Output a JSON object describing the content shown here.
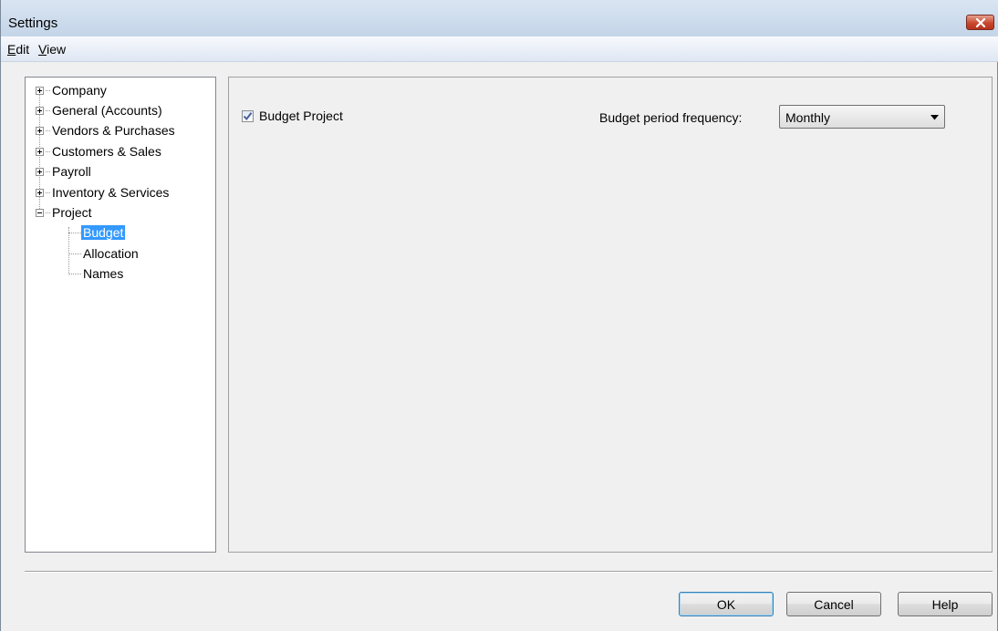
{
  "window": {
    "title": "Settings"
  },
  "menu": {
    "edit": {
      "mnemonic": "E",
      "rest": "dit"
    },
    "view": {
      "mnemonic": "V",
      "rest": "iew"
    }
  },
  "tree": {
    "items": [
      {
        "label": "Company",
        "expander": "plus"
      },
      {
        "label": "General (Accounts)",
        "expander": "plus"
      },
      {
        "label": "Vendors & Purchases",
        "expander": "plus"
      },
      {
        "label": "Customers & Sales",
        "expander": "plus"
      },
      {
        "label": "Payroll",
        "expander": "plus"
      },
      {
        "label": "Inventory & Services",
        "expander": "plus"
      },
      {
        "label": "Project",
        "expander": "minus",
        "children": [
          {
            "label": "Budget",
            "selected": true
          },
          {
            "label": "Allocation"
          },
          {
            "label": "Names"
          }
        ]
      }
    ]
  },
  "budget": {
    "budget_project_label": "Budget Project",
    "budget_project_checked": true,
    "frequency_label": "Budget period frequency:",
    "frequency_value": "Monthly"
  },
  "buttons": {
    "ok": "OK",
    "cancel": "Cancel",
    "help": "Help"
  },
  "colors": {
    "selection": "#3399ff",
    "close_button": "#c8492f",
    "default_button_border": "#3c7fb1"
  }
}
